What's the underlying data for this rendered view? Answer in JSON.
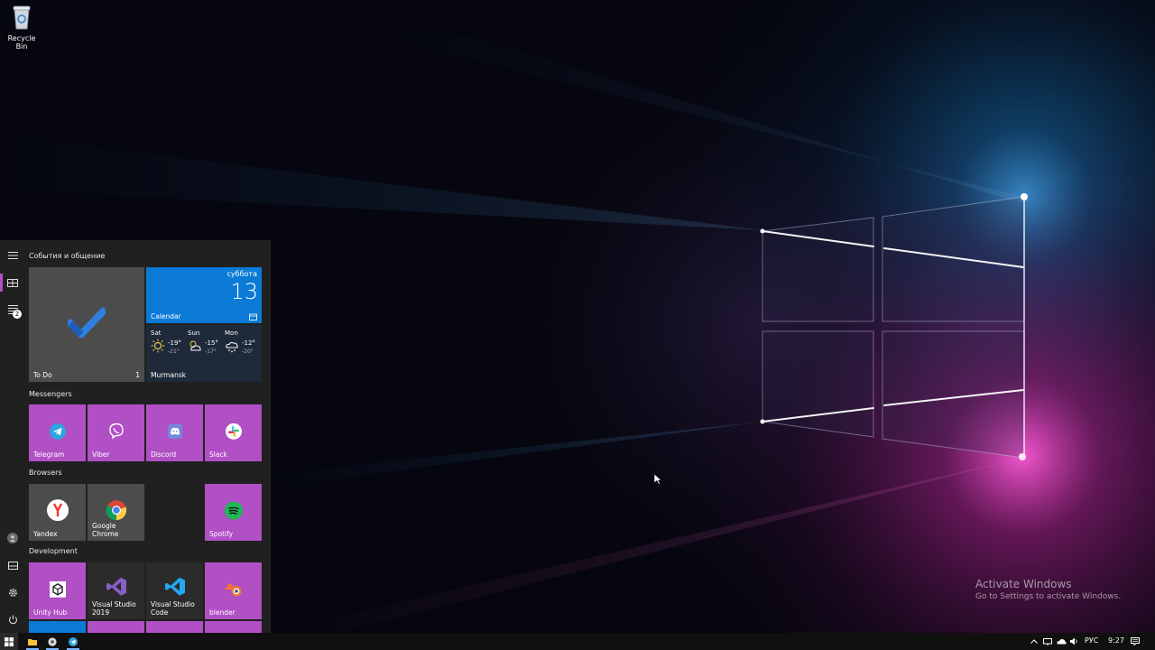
{
  "desktop": {
    "icons": [
      {
        "name": "recycle-bin-icon",
        "label": "Recycle Bin"
      }
    ],
    "watermark": {
      "title": "Activate Windows",
      "subtitle": "Go to Settings to activate Windows."
    }
  },
  "start_menu": {
    "rail": {
      "menu_icon": "hamburger-icon",
      "items": [
        {
          "icon": "tiles-icon",
          "active": true
        },
        {
          "icon": "all-apps-list-icon",
          "badge": "2"
        }
      ],
      "bottom": [
        {
          "icon": "user-avatar-icon"
        },
        {
          "icon": "documents-icon"
        },
        {
          "icon": "gear-icon"
        },
        {
          "icon": "power-icon"
        }
      ]
    },
    "groups": [
      {
        "label": "События и общение"
      },
      {
        "label": "Messengers"
      },
      {
        "label": "Browsers"
      },
      {
        "label": "Development"
      }
    ],
    "tiles": {
      "todo": {
        "label": "To Do",
        "count": "1"
      },
      "calendar": {
        "day": "суббота",
        "date": "13",
        "label": "Calendar"
      },
      "weather": {
        "location": "Murmansk",
        "days": [
          {
            "day": "Sat",
            "icon": "sunny-icon",
            "high": "-19°",
            "low": "-21°"
          },
          {
            "day": "Sun",
            "icon": "partly-cloudy-icon",
            "high": "-15°",
            "low": "-17°"
          },
          {
            "day": "Mon",
            "icon": "snow-cloud-icon",
            "high": "-12°",
            "low": "-20°"
          }
        ]
      },
      "messengers": [
        {
          "label": "Telegram",
          "icon": "telegram-icon"
        },
        {
          "label": "Viber",
          "icon": "viber-icon"
        },
        {
          "label": "Discord",
          "icon": "discord-icon"
        },
        {
          "label": "Slack",
          "icon": "slack-icon"
        }
      ],
      "browsers": [
        {
          "label": "Yandex",
          "icon": "yandex-icon"
        },
        {
          "label": "Google Chrome",
          "icon": "chrome-icon"
        },
        {
          "label": "Spotify",
          "icon": "spotify-icon"
        }
      ],
      "development": [
        {
          "label": "Unity Hub",
          "icon": "unity-hub-icon"
        },
        {
          "label": "Visual Studio\n2019",
          "icon": "visual-studio-icon"
        },
        {
          "label": "Visual Studio\nCode",
          "icon": "vscode-icon"
        },
        {
          "label": "blender",
          "icon": "blender-icon"
        }
      ]
    }
  },
  "taskbar": {
    "pinned": [
      {
        "icon": "windows-start-icon"
      },
      {
        "icon": "file-explorer-icon"
      },
      {
        "icon": "chrome-icon"
      },
      {
        "icon": "telegram-icon"
      }
    ],
    "tray": {
      "icons": [
        "chevron-up-icon",
        "network-icon",
        "onedrive-icon",
        "volume-icon"
      ],
      "language": "РУС",
      "time": "9:27",
      "notification_icon": "action-center-icon"
    }
  },
  "colors": {
    "tile_accent": "#b14fc5",
    "calendar_blue": "#0a7ad6",
    "start_bg": "#212121"
  }
}
